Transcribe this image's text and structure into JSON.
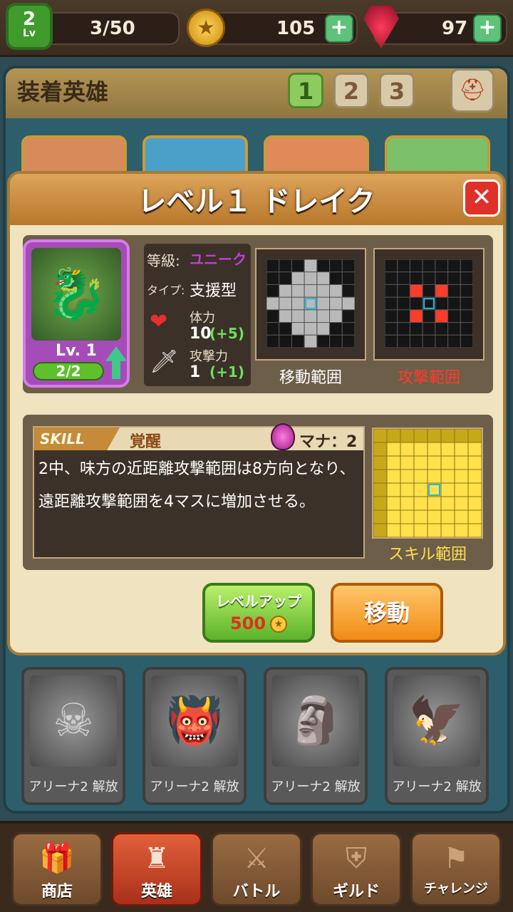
{
  "status_bar": {
    "player_level": "2",
    "player_level_unit": "Lv",
    "stamina": "3/50",
    "coins": "105",
    "gems": "97"
  },
  "equip": {
    "title": "装着英雄",
    "tabs": [
      "1",
      "2",
      "3"
    ],
    "active_tab": "1"
  },
  "modal": {
    "title": "レベル１ ドレイク",
    "hero": {
      "level": "Lv. 1",
      "xp": "2/2",
      "rarity_label": "等級:",
      "rarity": "ユニーク",
      "type_label": "タイプ:",
      "type": "支援型",
      "hp_label": "体力",
      "hp_value": "10",
      "hp_bonus": "(+5)",
      "atk_label": "攻撃力",
      "atk_value": "1",
      "atk_bonus": "(+1)"
    },
    "move_range_label": "移動範囲",
    "attack_range_label": "攻撃範囲",
    "skill": {
      "tag": "SKILL",
      "name": "覚醒",
      "mana": "マナ：2",
      "description": "2中、味方の近距離攻撃範囲は8方向となり、遠距離攻撃範囲を4マスに増加させる。",
      "range_label": "スキル範囲"
    },
    "level_up_label": "レベルアップ",
    "level_up_cost": "500",
    "move_button_label": "移動"
  },
  "locked_heroes": [
    {
      "label": "アリーナ2 解放"
    },
    {
      "label": "アリーナ2 解放"
    },
    {
      "label": "アリーナ2 解放"
    },
    {
      "label": "アリーナ2 解放"
    }
  ],
  "bottom_nav": [
    {
      "label": "商店",
      "icon": "gift-icon"
    },
    {
      "label": "英雄",
      "icon": "chess-rook-icon",
      "active": true
    },
    {
      "label": "バトル",
      "icon": "crossed-swords-icon"
    },
    {
      "label": "ギルド",
      "icon": "guild-icon"
    },
    {
      "label": "チャレンジ",
      "icon": "flag-icon"
    }
  ],
  "colors": {
    "rarity": "#c23cd8",
    "attack_range": "#ff3b2a",
    "skill_range": "#ffe14a"
  }
}
